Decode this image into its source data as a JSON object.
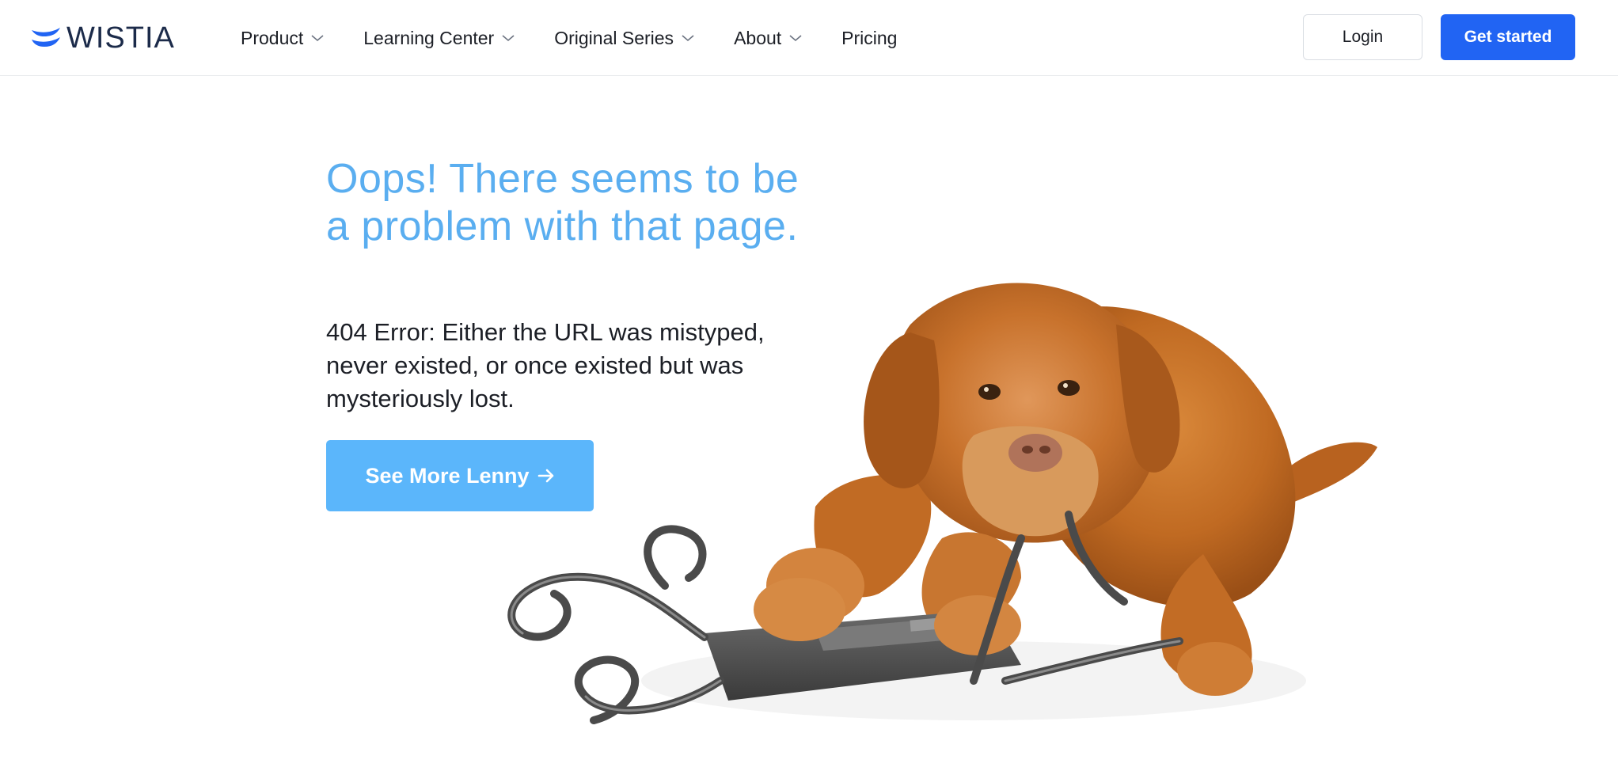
{
  "brand": {
    "name": "WISTIA",
    "primary_color": "#2164f3",
    "accent_color": "#5aaef0"
  },
  "nav": {
    "items": [
      {
        "label": "Product",
        "has_dropdown": true
      },
      {
        "label": "Learning Center",
        "has_dropdown": true
      },
      {
        "label": "Original Series",
        "has_dropdown": true
      },
      {
        "label": "About",
        "has_dropdown": true
      },
      {
        "label": "Pricing",
        "has_dropdown": false
      }
    ]
  },
  "header_actions": {
    "login_label": "Login",
    "get_started_label": "Get started"
  },
  "hero": {
    "headline": "Oops! There seems to be a problem with that page.",
    "message": "404 Error: Either the URL was mistyped, never existed, or once existed but was mysteriously lost.",
    "cta_label": "See More Lenny",
    "image_icon": "dog-with-vhs-tape-illustration"
  }
}
